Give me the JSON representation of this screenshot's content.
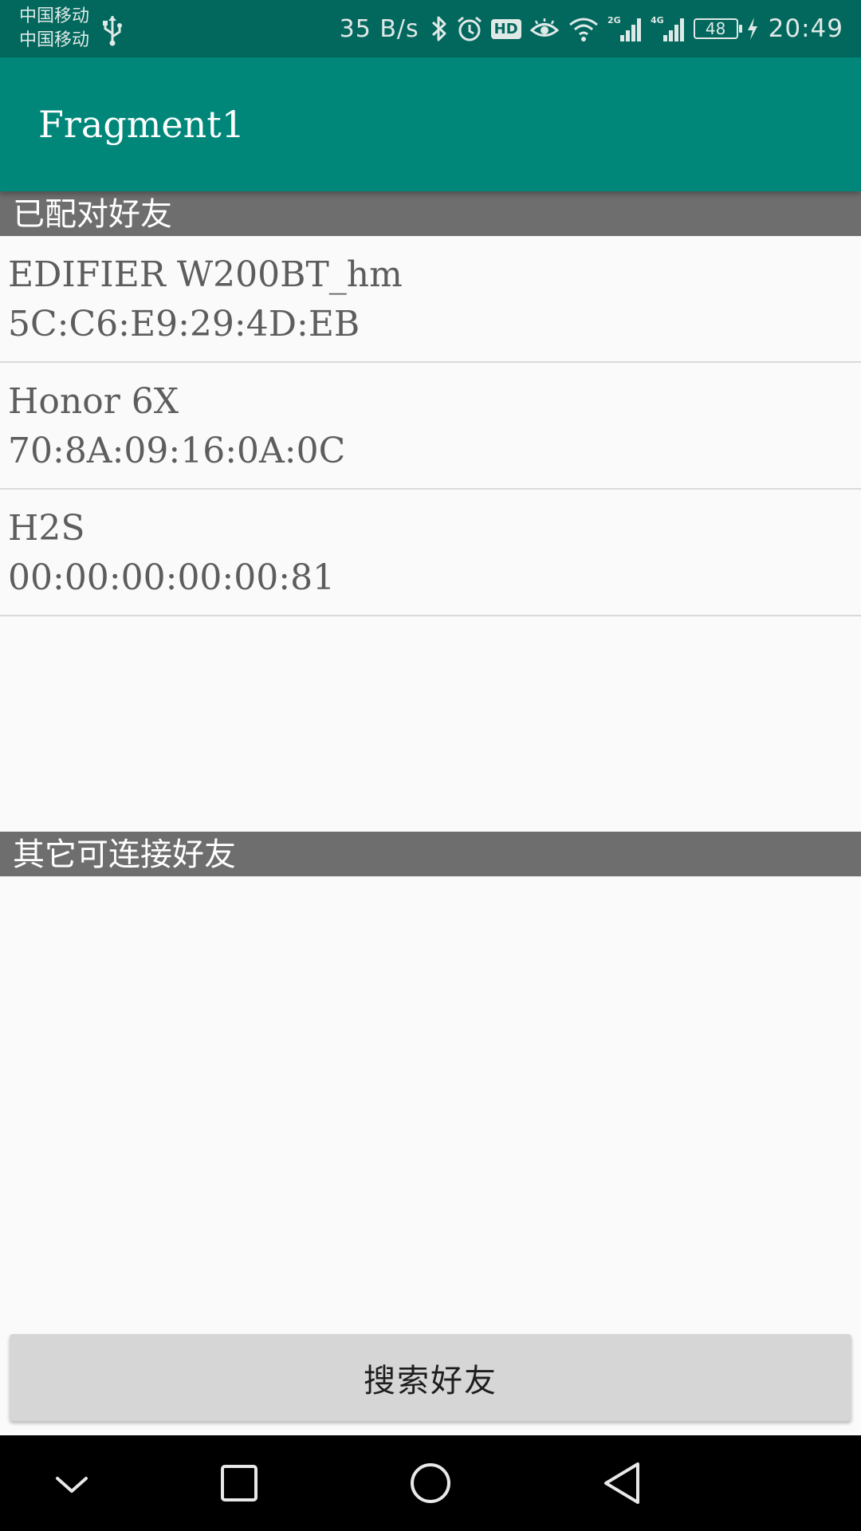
{
  "status_bar": {
    "carrier_1": "中国移动",
    "carrier_2": "中国移动",
    "net_speed": "35 B/s",
    "battery_level": "48",
    "time": "20:49",
    "hd_label": "HD",
    "signal_2g_label": "2G",
    "signal_4g_label": "4G"
  },
  "app_bar": {
    "title": "Fragment1"
  },
  "paired_section": {
    "header": "已配对好友",
    "devices": [
      {
        "name": "EDIFIER W200BT_hm",
        "address": "5C:C6:E9:29:4D:EB"
      },
      {
        "name": "Honor 6X",
        "address": "70:8A:09:16:0A:0C"
      },
      {
        "name": "H2S",
        "address": "00:00:00:00:00:81"
      }
    ]
  },
  "other_section": {
    "header": "其它可连接好友"
  },
  "search_button": {
    "label": "搜索好友"
  },
  "colors": {
    "status_bar": "#02675d",
    "app_bar": "#00877a",
    "section_header": "#6e6e6e",
    "button": "#d6d6d6"
  }
}
